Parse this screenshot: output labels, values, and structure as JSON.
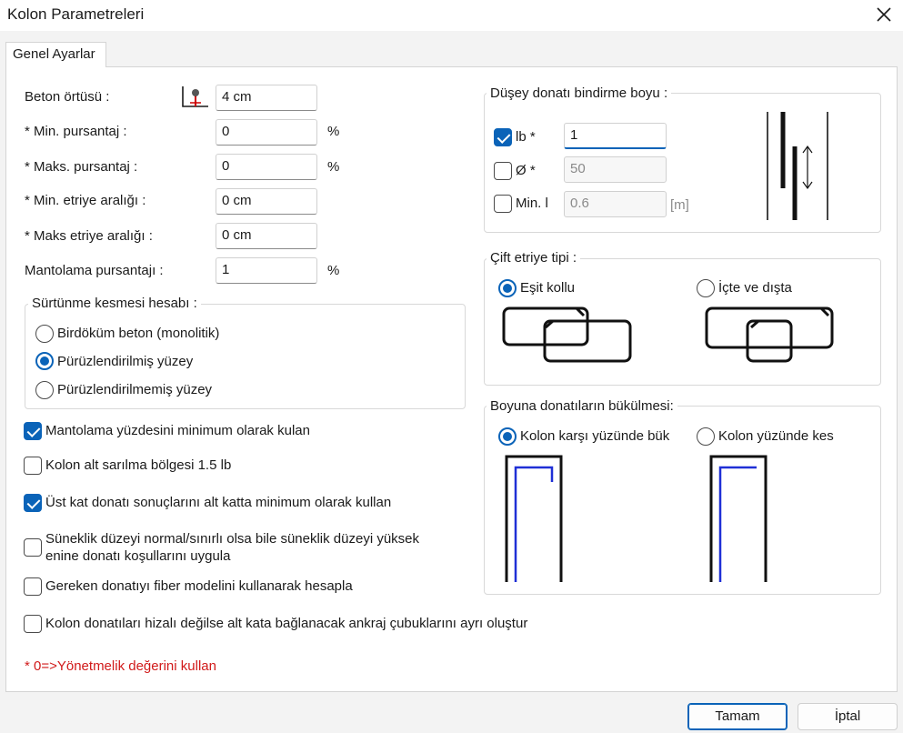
{
  "window": {
    "title": "Kolon Parametreleri"
  },
  "tabs": [
    {
      "label": "Genel Ayarlar"
    }
  ],
  "fields": {
    "beton_ortusu": {
      "label": "Beton örtüsü :",
      "value": "4 cm"
    },
    "min_pursantaj": {
      "label": "* Min.  pursantaj :",
      "value": "0",
      "unit": "%"
    },
    "maks_pursantaj": {
      "label": "* Maks. pursantaj :",
      "value": "0",
      "unit": "%"
    },
    "min_etriye": {
      "label": "* Min. etriye aralığı :",
      "value": "0 cm"
    },
    "maks_etriye": {
      "label": "* Maks etriye aralığı :",
      "value": "0 cm"
    },
    "mantolama": {
      "label": "Mantolama pursantajı :",
      "value": "1",
      "unit": "%"
    }
  },
  "surtunme": {
    "title": "Sürtünme kesmesi hesabı :",
    "options": [
      {
        "label": "Birdöküm beton (monolitik)",
        "selected": false
      },
      {
        "label": "Pürüzlendirilmiş yüzey",
        "selected": true
      },
      {
        "label": "Pürüzlendirilmemiş yüzey",
        "selected": false
      }
    ]
  },
  "checkboxes": [
    {
      "label": "Mantolama yüzdesini minimum olarak kulan",
      "checked": true
    },
    {
      "label": "Kolon alt sarılma bölgesi 1.5 lb",
      "checked": false
    },
    {
      "label": "Üst kat donatı sonuçlarını alt katta minimum olarak kullan",
      "checked": true
    },
    {
      "label": "Süneklik düzeyi normal/sınırlı olsa bile süneklik düzeyi yüksek",
      "label2": "enine donatı koşullarını uygula",
      "checked": false
    },
    {
      "label": "Gereken donatıyı fiber modelini kullanarak hesapla",
      "checked": false
    },
    {
      "label": "Kolon donatıları hizalı değilse alt kata bağlanacak ankraj çubuklarını ayrı oluştur",
      "checked": false
    }
  ],
  "note": "* 0=>Yönetmelik değerini kullan",
  "bindirme": {
    "title": "Düşey donatı bindirme boyu :",
    "rows": [
      {
        "label": "lb *",
        "checked": true,
        "value": "1"
      },
      {
        "label": "Ø *",
        "checked": false,
        "value": "50"
      },
      {
        "label": "Min. l",
        "checked": false,
        "value": "0.6",
        "unit": "[m]"
      }
    ]
  },
  "cift_etriye": {
    "title": "Çift etriye tipi :",
    "options": [
      {
        "label": "Eşit kollu",
        "selected": true
      },
      {
        "label": "İçte ve dışta",
        "selected": false
      }
    ]
  },
  "bukulme": {
    "title": "Boyuna donatıların bükülmesi:",
    "options": [
      {
        "label": "Kolon karşı yüzünde bük",
        "selected": true
      },
      {
        "label": "Kolon yüzünde kes",
        "selected": false
      }
    ]
  },
  "buttons": {
    "ok": "Tamam",
    "cancel": "İptal"
  },
  "colors": {
    "accent": "#0a63b8",
    "note_red": "#d11a1a",
    "rebar_blue": "#1f2fd6",
    "cover_red": "#cc0000"
  }
}
